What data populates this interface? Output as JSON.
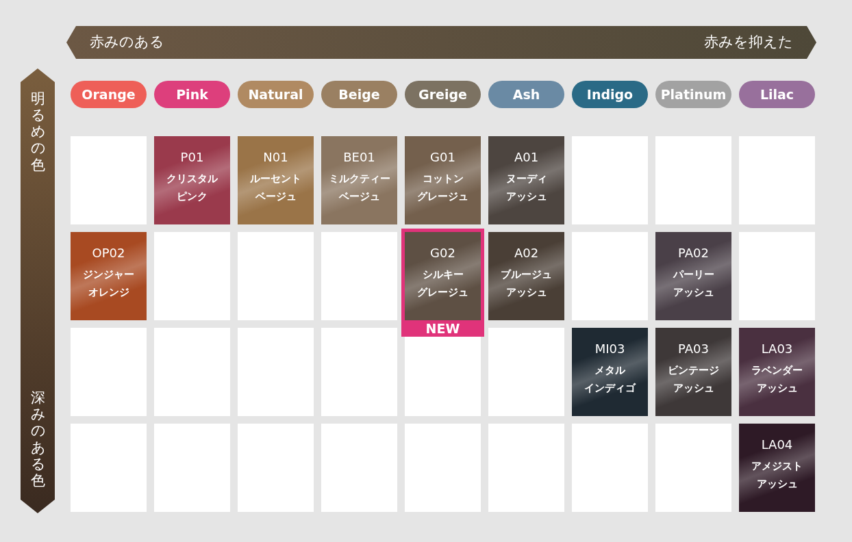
{
  "horizontal_axis": {
    "left_label": "赤みのある",
    "right_label": "赤みを抑えた"
  },
  "vertical_axis": {
    "top_label": "明るめの色",
    "bottom_label": "深みのある色"
  },
  "categories": [
    {
      "label": "Orange",
      "color": "#ee5f58"
    },
    {
      "label": "Pink",
      "color": "#dd3f7c"
    },
    {
      "label": "Natural",
      "color": "#b08a62"
    },
    {
      "label": "Beige",
      "color": "#9a8062"
    },
    {
      "label": "Greige",
      "color": "#7c7262"
    },
    {
      "label": "Ash",
      "color": "#6a8aa4"
    },
    {
      "label": "Indigo",
      "color": "#2a6a86"
    },
    {
      "label": "Platinum",
      "color": "#a2a2a2"
    },
    {
      "label": "Lilac",
      "color": "#98709c"
    }
  ],
  "rows": [
    {
      "cells": [
        {
          "kind": "empty"
        },
        {
          "kind": "swatch",
          "code": "P01",
          "name_lines": [
            "クリスタル",
            "ピンク"
          ],
          "color": "#9a3a4c"
        },
        {
          "kind": "swatch",
          "code": "N01",
          "name_lines": [
            "ルーセント",
            "ベージュ"
          ],
          "color": "#9a7448"
        },
        {
          "kind": "swatch",
          "code": "BE01",
          "name_lines": [
            "ミルクティー",
            "ベージュ"
          ],
          "color": "#8a7560"
        },
        {
          "kind": "swatch",
          "code": "G01",
          "name_lines": [
            "コットン",
            "グレージュ"
          ],
          "color": "#74604d"
        },
        {
          "kind": "swatch",
          "code": "A01",
          "name_lines": [
            "ヌーディ",
            "アッシュ"
          ],
          "color": "#4d4540"
        },
        {
          "kind": "empty"
        },
        {
          "kind": "empty"
        },
        {
          "kind": "empty"
        }
      ]
    },
    {
      "cells": [
        {
          "kind": "swatch",
          "code": "OP02",
          "name_lines": [
            "ジンジャー",
            "オレンジ"
          ],
          "color": "#a84a22"
        },
        {
          "kind": "empty"
        },
        {
          "kind": "empty"
        },
        {
          "kind": "empty"
        },
        {
          "kind": "swatch",
          "code": "G02",
          "name_lines": [
            "シルキー",
            "グレージュ"
          ],
          "color": "#5e5044",
          "badge": "NEW"
        },
        {
          "kind": "swatch",
          "code": "A02",
          "name_lines": [
            "ブルージュ",
            "アッシュ"
          ],
          "color": "#4a3f36"
        },
        {
          "kind": "empty"
        },
        {
          "kind": "swatch",
          "code": "PA02",
          "name_lines": [
            "パーリー",
            "アッシュ"
          ],
          "color": "#4a4048"
        },
        {
          "kind": "empty"
        }
      ]
    },
    {
      "cells": [
        {
          "kind": "empty"
        },
        {
          "kind": "empty"
        },
        {
          "kind": "empty"
        },
        {
          "kind": "empty"
        },
        {
          "kind": "empty"
        },
        {
          "kind": "empty"
        },
        {
          "kind": "swatch",
          "code": "MI03",
          "name_lines": [
            "メタル",
            "インディゴ"
          ],
          "color": "#1f2a33"
        },
        {
          "kind": "swatch",
          "code": "PA03",
          "name_lines": [
            "ビンテージ",
            "アッシュ"
          ],
          "color": "#3e3838"
        },
        {
          "kind": "swatch",
          "code": "LA03",
          "name_lines": [
            "ラベンダー",
            "アッシュ"
          ],
          "color": "#4a3040"
        }
      ]
    },
    {
      "cells": [
        {
          "kind": "empty"
        },
        {
          "kind": "empty"
        },
        {
          "kind": "empty"
        },
        {
          "kind": "empty"
        },
        {
          "kind": "empty"
        },
        {
          "kind": "empty"
        },
        {
          "kind": "empty"
        },
        {
          "kind": "empty"
        },
        {
          "kind": "swatch",
          "code": "LA04",
          "name_lines": [
            "アメジスト",
            "アッシュ"
          ],
          "color": "#2e1a26"
        }
      ]
    }
  ]
}
